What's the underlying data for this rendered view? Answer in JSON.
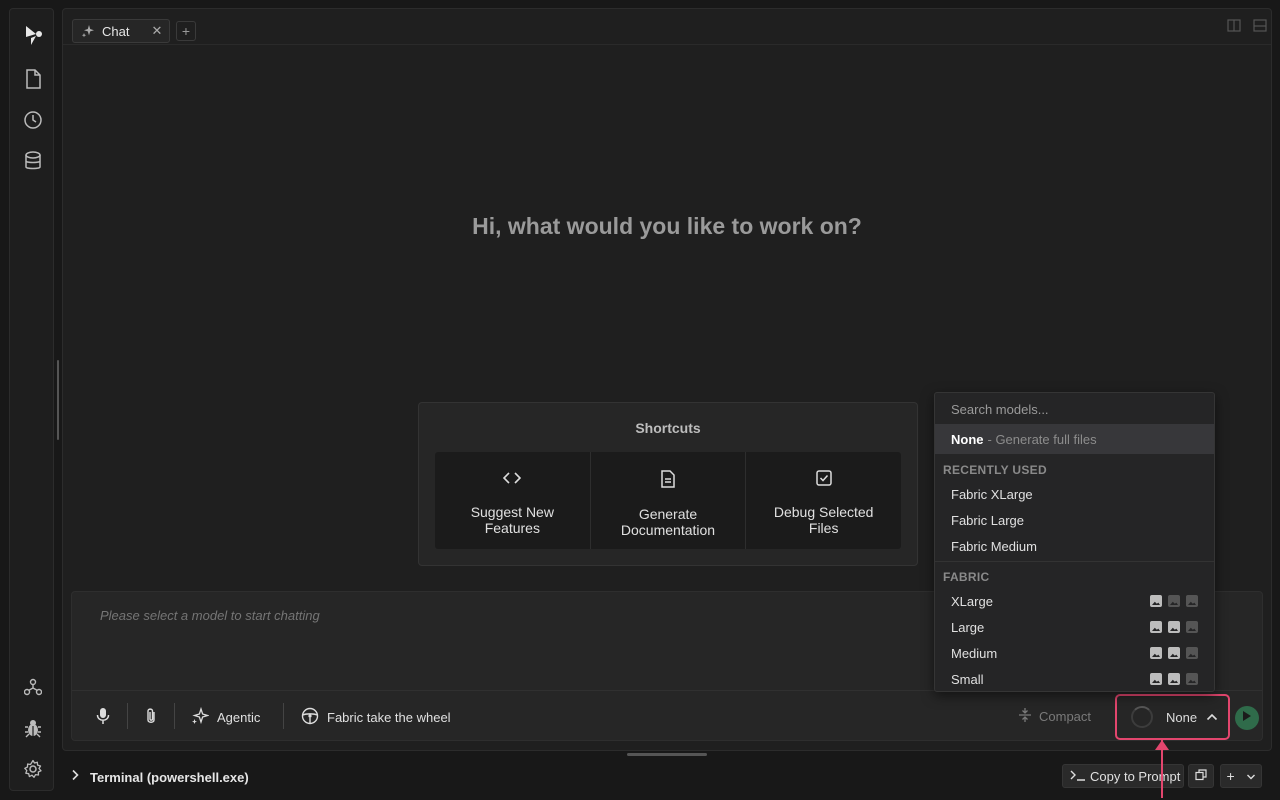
{
  "tabs": [
    {
      "label": "Chat"
    }
  ],
  "greeting": "Hi, what would you like to work on?",
  "shortcuts": {
    "title": "Shortcuts",
    "items": [
      {
        "label": "Suggest New Features",
        "icon": "code-icon"
      },
      {
        "label": "Generate Documentation",
        "icon": "document-icon"
      },
      {
        "label": "Debug Selected Files",
        "icon": "checkbox-icon"
      }
    ]
  },
  "chat": {
    "placeholder": "Please select a model to start chatting",
    "agentic_label": "Agentic",
    "wheel_label": "Fabric take the wheel",
    "compact_label": "Compact",
    "model_label": "None"
  },
  "terminal": {
    "title": "Terminal (powershell.exe)",
    "copy_label": "Copy to Prompt"
  },
  "model_dropdown": {
    "search_placeholder": "Search models...",
    "selected": {
      "name": "None",
      "description": "- Generate full files"
    },
    "recently_used_header": "RECENTLY USED",
    "recently_used": [
      "Fabric XLarge",
      "Fabric Large",
      "Fabric Medium"
    ],
    "fabric_header": "FABRIC",
    "fabric_models": [
      {
        "name": "XLarge",
        "capabilities": [
          true,
          false,
          false
        ]
      },
      {
        "name": "Large",
        "capabilities": [
          true,
          true,
          false
        ]
      },
      {
        "name": "Medium",
        "capabilities": [
          true,
          true,
          false
        ]
      },
      {
        "name": "Small",
        "capabilities": [
          true,
          true,
          false
        ]
      }
    ]
  },
  "colors": {
    "accent": "#e3466e",
    "send": "#2f6b4a",
    "background": "#1f1f1f"
  }
}
